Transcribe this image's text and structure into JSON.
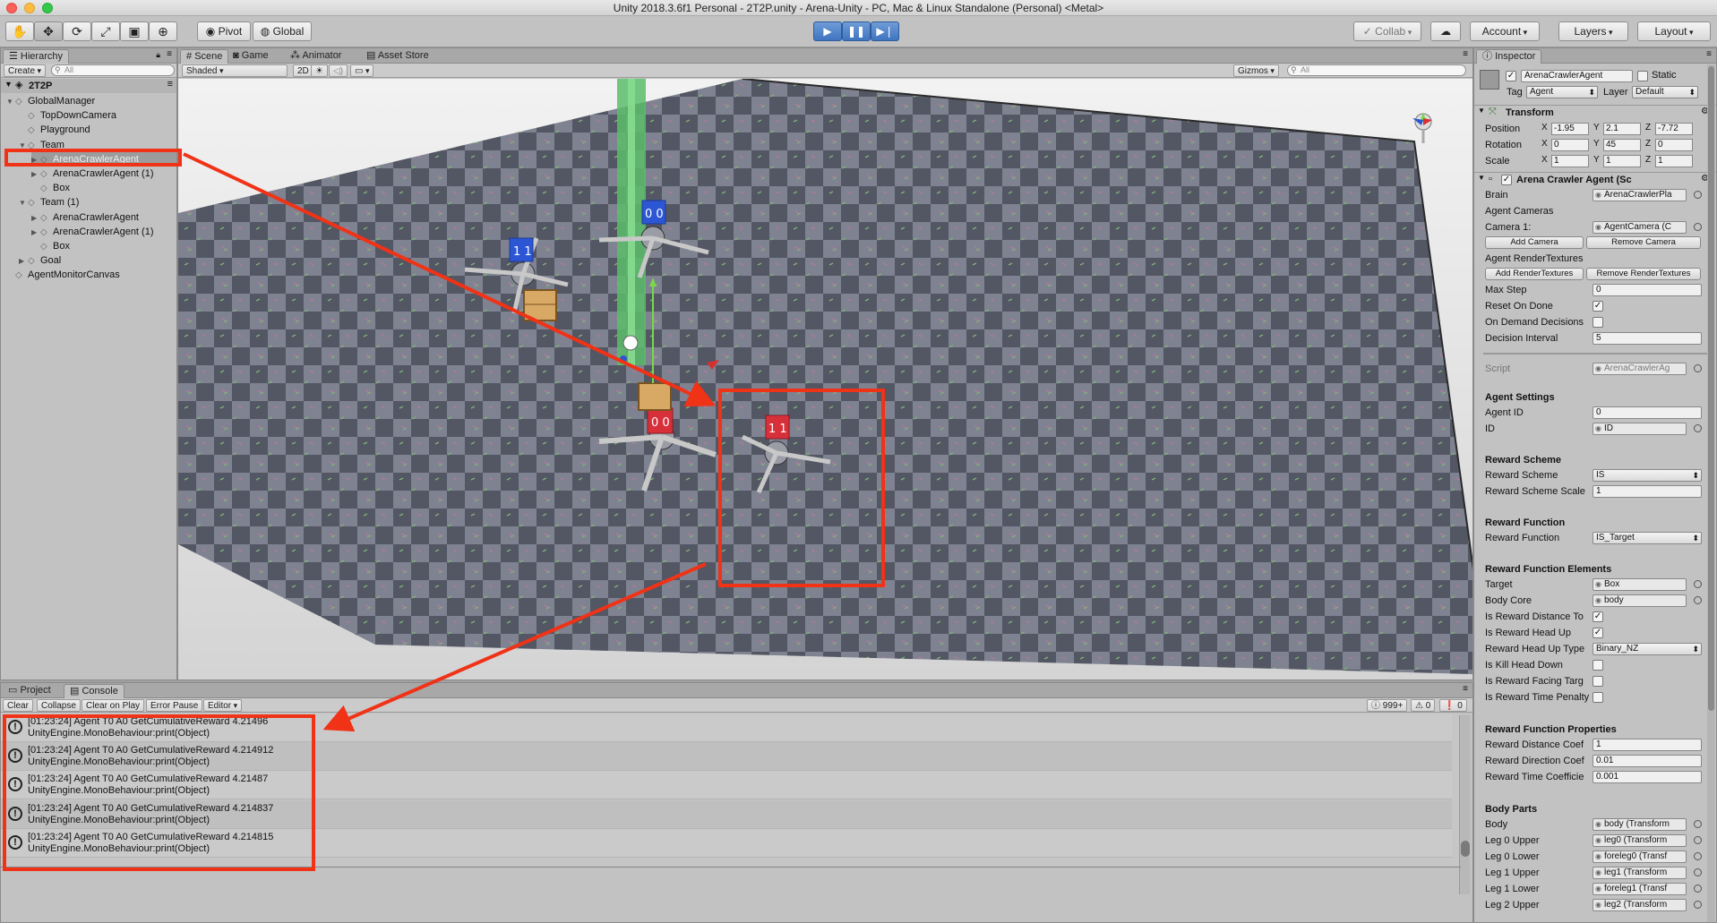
{
  "window": {
    "title": "Unity 2018.3.6f1 Personal - 2T2P.unity - Arena-Unity - PC, Mac & Linux Standalone (Personal) <Metal>"
  },
  "toolbar": {
    "pivot_label": "Pivot",
    "global_label": "Global",
    "collab_label": "Collab",
    "account_label": "Account",
    "layers_label": "Layers",
    "layout_label": "Layout"
  },
  "hierarchy": {
    "tab": "Hierarchy",
    "create_label": "Create",
    "search_placeholder": "All",
    "scene_name": "2T2P",
    "items": [
      {
        "label": "GlobalManager"
      },
      {
        "label": "TopDownCamera"
      },
      {
        "label": "Playground"
      },
      {
        "label": "Team"
      },
      {
        "label": "ArenaCrawlerAgent"
      },
      {
        "label": "ArenaCrawlerAgent (1)"
      },
      {
        "label": "Box"
      },
      {
        "label": "Team (1)"
      },
      {
        "label": "ArenaCrawlerAgent"
      },
      {
        "label": "ArenaCrawlerAgent (1)"
      },
      {
        "label": "Box"
      },
      {
        "label": "Goal"
      },
      {
        "label": "AgentMonitorCanvas"
      }
    ]
  },
  "scene": {
    "tabs": [
      "Scene",
      "Game",
      "Animator",
      "Asset Store"
    ],
    "shading_mode": "Shaded",
    "mode_2d": "2D",
    "gizmos_label": "Gizmos",
    "search_placeholder": "All",
    "box_digits": {
      "blue_left": "1 1",
      "blue_right": "0 0",
      "red_center": "0 0",
      "red_right": "1 1"
    }
  },
  "console": {
    "tabs": [
      "Project",
      "Console"
    ],
    "buttons": [
      "Clear",
      "Collapse",
      "Clear on Play",
      "Error Pause",
      "Editor"
    ],
    "counts": {
      "log": "999+",
      "warn": "0",
      "error": "0"
    },
    "entries": [
      {
        "line1": "[01:23:24] Agent T0 A0 GetCumulativeReward 4.21496",
        "line2": "UnityEngine.MonoBehaviour:print(Object)"
      },
      {
        "line1": "[01:23:24] Agent T0 A0 GetCumulativeReward 4.214912",
        "line2": "UnityEngine.MonoBehaviour:print(Object)"
      },
      {
        "line1": "[01:23:24] Agent T0 A0 GetCumulativeReward 4.21487",
        "line2": "UnityEngine.MonoBehaviour:print(Object)"
      },
      {
        "line1": "[01:23:24] Agent T0 A0 GetCumulativeReward 4.214837",
        "line2": "UnityEngine.MonoBehaviour:print(Object)"
      },
      {
        "line1": "[01:23:24] Agent T0 A0 GetCumulativeReward 4.214815",
        "line2": "UnityEngine.MonoBehaviour:print(Object)"
      }
    ]
  },
  "inspector": {
    "tab": "Inspector",
    "object_name": "ArenaCrawlerAgent",
    "static_label": "Static",
    "tag_label": "Tag",
    "tag_value": "Agent",
    "layer_label": "Layer",
    "layer_value": "Default",
    "transform": {
      "title": "Transform",
      "position_label": "Position",
      "position": [
        "-1.95",
        "2.1",
        "-7.72"
      ],
      "rotation_label": "Rotation",
      "rotation": [
        "0",
        "45",
        "0"
      ],
      "scale_label": "Scale",
      "scale": [
        "1",
        "1",
        "1"
      ]
    },
    "component_title": "Arena Crawler Agent (Sc",
    "brain_label": "Brain",
    "brain_value": "ArenaCrawlerPla",
    "agent_cameras_label": "Agent Cameras",
    "camera1_label": "Camera 1:",
    "camera1_value": "AgentCamera (C",
    "add_camera": "Add Camera",
    "remove_camera": "Remove Camera",
    "agent_rt_label": "Agent RenderTextures",
    "add_rt": "Add RenderTextures",
    "remove_rt": "Remove RenderTextures",
    "max_step_label": "Max Step",
    "max_step": "0",
    "reset_on_done_label": "Reset On Done",
    "on_demand_label": "On Demand Decisions",
    "decision_interval_label": "Decision Interval",
    "decision_interval": "5",
    "script_label": "Script",
    "script_value": "ArenaCrawlerAg",
    "agent_settings_head": "Agent Settings",
    "agent_id_label": "Agent ID",
    "agent_id": "0",
    "id_label": "ID",
    "id_value": "ID",
    "reward_scheme_head": "Reward Scheme",
    "reward_scheme_label": "Reward Scheme",
    "reward_scheme": "IS",
    "reward_scheme_scale_label": "Reward Scheme Scale",
    "reward_scheme_scale": "1",
    "reward_function_head": "Reward Function",
    "reward_function_label": "Reward Function",
    "reward_function": "IS_Target",
    "rf_elements_head": "Reward Function Elements",
    "target_label": "Target",
    "target_value": "Box",
    "body_core_label": "Body Core",
    "body_core_value": "body",
    "is_reward_distance_label": "Is Reward Distance To",
    "is_reward_head_up_label": "Is Reward Head Up",
    "reward_head_up_type_label": "Reward Head Up Type",
    "reward_head_up_type": "Binary_NZ",
    "is_kill_head_down_label": "Is Kill Head Down",
    "is_reward_facing_label": "Is Reward Facing Targ",
    "is_reward_time_label": "Is Reward Time Penalty",
    "rf_properties_head": "Reward Function Properties",
    "reward_distance_coef_label": "Reward Distance Coef",
    "reward_distance_coef": "1",
    "reward_direction_coef_label": "Reward Direction Coef",
    "reward_direction_coef": "0.01",
    "reward_time_coef_label": "Reward Time Coefficie",
    "reward_time_coef": "0.001",
    "body_parts_head": "Body Parts",
    "body_parts": [
      {
        "label": "Body",
        "value": "body (Transform"
      },
      {
        "label": "Leg 0 Upper",
        "value": "leg0 (Transform"
      },
      {
        "label": "Leg 0 Lower",
        "value": "foreleg0 (Transf"
      },
      {
        "label": "Leg 1 Upper",
        "value": "leg1 (Transform"
      },
      {
        "label": "Leg 1 Lower",
        "value": "foreleg1 (Transf"
      },
      {
        "label": "Leg 2 Upper",
        "value": "leg2 (Transform"
      }
    ]
  }
}
